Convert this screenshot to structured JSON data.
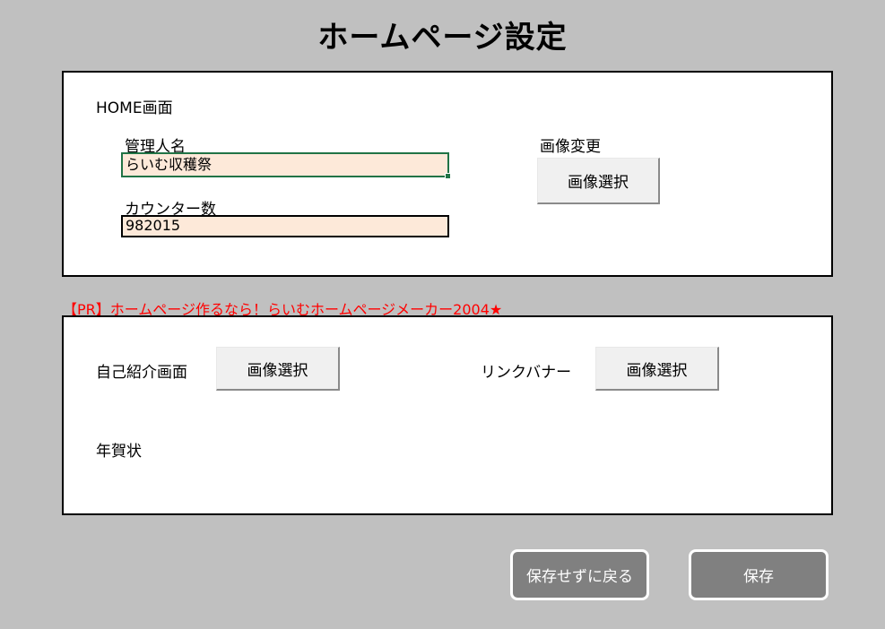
{
  "page": {
    "title": "ホームページ設定"
  },
  "home": {
    "section_label": "HOME画面",
    "admin_name_label": "管理人名",
    "admin_name_value": "らいむ収穫祭",
    "counter_label": "カウンター数",
    "counter_value": "982015",
    "image_change_label": "画像変更",
    "image_select_button": "画像選択"
  },
  "promo": {
    "text": "【PR】ホームページ作るなら！らいむホームページメーカー2004★"
  },
  "sections": {
    "self_intro_label": "自己紹介画面",
    "self_intro_button": "画像選択",
    "link_banner_label": "リンクバナー",
    "link_banner_button": "画像選択",
    "new_year_card_label": "年賀状"
  },
  "footer": {
    "cancel_button": "保存せずに戻る",
    "save_button": "保存"
  },
  "colors": {
    "background": "#c0c0c0",
    "input_fill": "#fde9d9",
    "selection_border": "#217346",
    "promo_text": "#ff0000",
    "action_button": "#808080"
  }
}
